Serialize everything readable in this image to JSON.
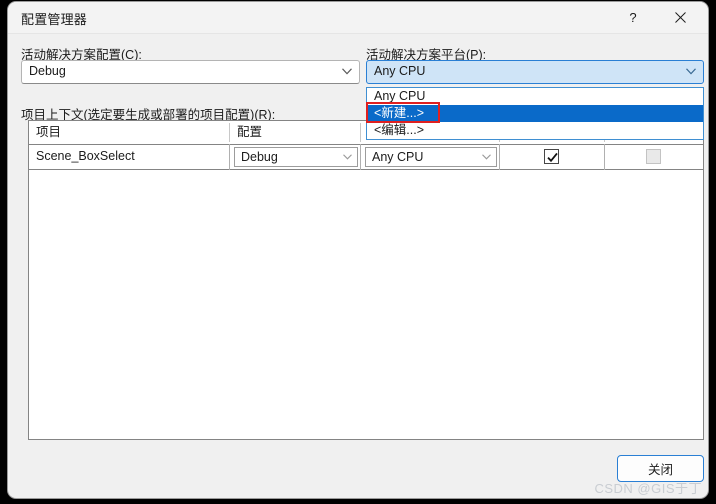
{
  "window": {
    "title": "配置管理器",
    "help_icon": "question-mark-icon",
    "close_icon": "close-x-icon"
  },
  "solution_configuration": {
    "label_prefix": "活动解决方案配置(",
    "label_accel": "C",
    "label_suffix": "):",
    "value": "Debug",
    "chevron_icon": "chevron-down-icon"
  },
  "solution_platform": {
    "label_prefix": "活动解决方案平台(",
    "label_accel": "P",
    "label_suffix": "):",
    "value": "Any CPU",
    "chevron_icon": "chevron-down-icon",
    "expanded": true,
    "options": [
      {
        "label": "Any CPU",
        "selected": false
      },
      {
        "label": "<新建...>",
        "selected": true
      },
      {
        "label": "<编辑...>",
        "selected": false
      }
    ]
  },
  "project_contexts": {
    "label_prefix": "项目上下文(选定要生成或部署的项目配置)(",
    "label_accel": "R",
    "label_suffix": "):",
    "columns": [
      {
        "header": "项目"
      },
      {
        "header": "配置"
      },
      {
        "header": ""
      },
      {
        "header": ""
      },
      {
        "header": ""
      }
    ],
    "rows": [
      {
        "project": "Scene_BoxSelect",
        "configuration": "Debug",
        "platform": "Any CPU",
        "build": true,
        "deploy": false,
        "deploy_enabled": false,
        "chevron_icon": "chevron-down-icon",
        "check_icon": "check-mark-icon"
      }
    ]
  },
  "footer": {
    "close_label": "关闭"
  },
  "watermark": {
    "text": "CSDN @GIS于丁"
  },
  "colors": {
    "accent": "#0a6ac9",
    "annotation": "#e02020",
    "focus_border": "#2a7fd4",
    "combo_focus_bg": "#cfe4f7"
  }
}
